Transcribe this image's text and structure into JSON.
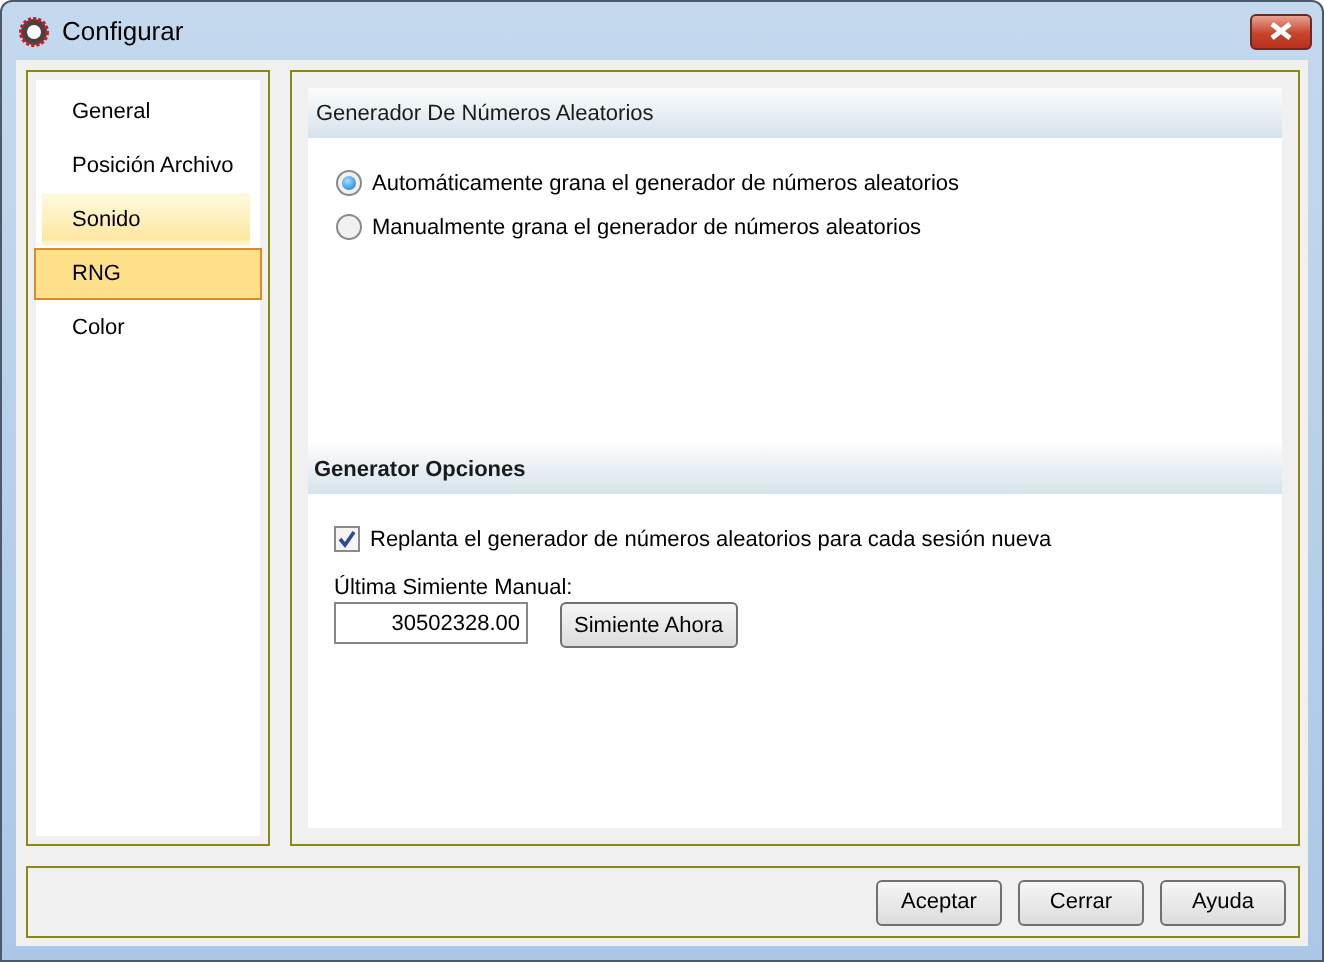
{
  "window": {
    "title": "Configurar"
  },
  "sidebar": {
    "items": [
      {
        "label": "General",
        "selected": false,
        "highlighted": false
      },
      {
        "label": "Posición Archivo",
        "selected": false,
        "highlighted": false
      },
      {
        "label": "Sonido",
        "selected": false,
        "highlighted": true
      },
      {
        "label": "RNG",
        "selected": true,
        "highlighted": false
      },
      {
        "label": "Color",
        "selected": false,
        "highlighted": false
      }
    ]
  },
  "generator": {
    "title": "Generador De Números Aleatorios",
    "options": [
      {
        "label": "Automáticamente grana el generador de números aleatorios",
        "selected": true
      },
      {
        "label": "Manualmente grana el generador de números aleatorios",
        "selected": false
      }
    ]
  },
  "options": {
    "title": "Generator Opciones",
    "reseed": {
      "label": "Replanta el generador de números aleatorios para cada sesión nueva",
      "checked": true
    },
    "seed_label": "Última Simiente Manual:",
    "seed_value": "30502328.00",
    "seed_button": "Simiente Ahora"
  },
  "buttons": [
    "Aceptar",
    "Cerrar",
    "Ayuda"
  ]
}
